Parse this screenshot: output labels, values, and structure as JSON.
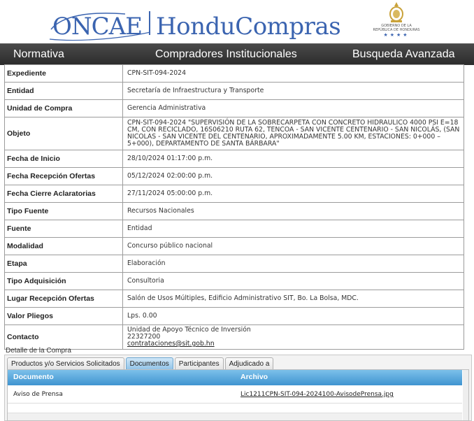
{
  "header": {
    "logo_left": "ONCAE",
    "logo_right": "HonduCompras",
    "gov_text_1": "GOBIERNO DE LA",
    "gov_text_2": "REPÚBLICA DE HONDURAS",
    "gov_stars": "★★★★"
  },
  "nav": {
    "normativa": "Normativa",
    "compradores": "Compradores Institucionales",
    "busqueda": "Busqueda Avanzada"
  },
  "details": [
    {
      "label": "Expediente",
      "value": "CPN-SIT-094-2024"
    },
    {
      "label": "Entidad",
      "value": "Secretaría de Infraestructura y Transporte"
    },
    {
      "label": "Unidad de Compra",
      "value": "Gerencia Administrativa"
    },
    {
      "label": "Objeto",
      "value": "CPN-SIT-094-2024 \"SUPERVISIÓN DE LA SOBRECARPETA CON CONCRETO HIDRAULICO 4000 PSI E=18 CM, CON RECICLADO, 16S06210 RUTA 62, TENCOA - SAN VICENTE CENTENARIO - SAN NICOLÁS, (SAN NICOLAS - SAN VICENTE DEL CENTENARIO, APROXIMADAMENTE 5.00 KM, ESTACIONES: 0+000 – 5+000), DEPARTAMENTO DE SANTA BÁRBARA\""
    },
    {
      "label": "Fecha de Inicio",
      "value": "28/10/2024 01:17:00 p.m."
    },
    {
      "label": "Fecha Recepción Ofertas",
      "value": "05/12/2024 02:00:00 p.m."
    },
    {
      "label": "Fecha Cierre Aclaratorias",
      "value": "27/11/2024 05:00:00 p.m."
    },
    {
      "label": "Tipo Fuente",
      "value": "Recursos Nacionales"
    },
    {
      "label": "Fuente",
      "value": "Entidad"
    },
    {
      "label": "Modalidad",
      "value": "Concurso público nacional"
    },
    {
      "label": "Etapa",
      "value": "Elaboración"
    },
    {
      "label": "Tipo Adquisición",
      "value": "Consultoria"
    },
    {
      "label": "Lugar Recepción Ofertas",
      "value": "Salón de Usos Múltiples, Edificio Administrativo SIT, Bo. La Bolsa, MDC."
    },
    {
      "label": "Valor Pliegos",
      "value": "Lps. 0.00"
    }
  ],
  "contacto": {
    "label": "Contacto",
    "line1": "Unidad de Apoyo Técnico de Inversión",
    "line2": "22327200",
    "email": "contrataciones@sit.gob.hn"
  },
  "detalle_title": "Detalle de la Compra",
  "tabs": [
    {
      "label": "Productos y/o Servicios Solicitados",
      "active": false
    },
    {
      "label": "Documentos",
      "active": true
    },
    {
      "label": "Participantes",
      "active": false
    },
    {
      "label": "Adjudicado a",
      "active": false
    }
  ],
  "grid": {
    "col_documento": "Documento",
    "col_archivo": "Archivo",
    "rows": [
      {
        "documento": "Aviso de Prensa",
        "archivo": "Lic1211CPN-SIT-094-2024100-AvisodePrensa.jpg"
      }
    ]
  },
  "colors": {
    "brand_blue": "#3b64b0",
    "nav_bg": "#333333",
    "grid_header": "#4a9bd4",
    "active_tab": "#a9d2f0"
  }
}
